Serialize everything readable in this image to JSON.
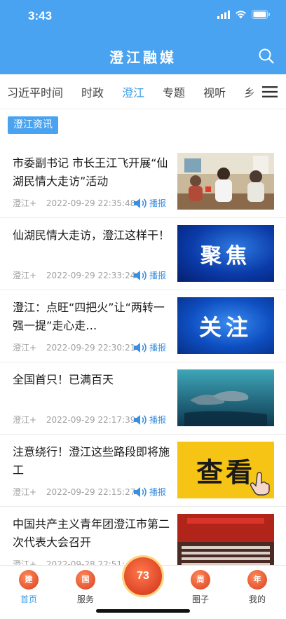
{
  "status_bar": {
    "time": "3:43"
  },
  "header": {
    "title": "澄江融媒"
  },
  "tabs": [
    {
      "label": "习近平时间"
    },
    {
      "label": "时政"
    },
    {
      "label": "澄江"
    },
    {
      "label": "专题"
    },
    {
      "label": "视听"
    },
    {
      "label": "乡"
    }
  ],
  "section_label": "澄江资讯",
  "news": [
    {
      "title": "市委副书记 市长王江飞开展“仙湖民情大走访”活动",
      "source": "澄江+",
      "time": "2022-09-29 22:35:48",
      "play": "播报",
      "thumb": "photo"
    },
    {
      "title": "仙湖民情大走访，澄江这样干！",
      "source": "澄江+",
      "time": "2022-09-29 22:33:24",
      "play": "播报",
      "thumb_text": "聚焦"
    },
    {
      "title": "澄江：点旺“四把火”让“两转一强一提”走心走…",
      "source": "澄江+",
      "time": "2022-09-29 22:30:21",
      "play": "播报",
      "thumb_text": "关注"
    },
    {
      "title": "全国首只！已满百天",
      "source": "澄江+",
      "time": "2022-09-29 22:17:39",
      "play": "播报",
      "thumb": "dolphin"
    },
    {
      "title": "注意绕行！澄江这些路段即将施工",
      "source": "澄江+",
      "time": "2022-09-29 22:15:27",
      "play": "播报",
      "thumb_text": "查看"
    },
    {
      "title": "中国共产主义青年团澄江市第二次代表大会召开",
      "source": "澄江+",
      "time": "2022-09-28 22:51:",
      "play": "",
      "thumb": "hall"
    }
  ],
  "tabbar": [
    {
      "label": "首页",
      "icon_char": "建"
    },
    {
      "label": "服务",
      "icon_char": "国"
    },
    {
      "label": "圈子",
      "icon_char": "周"
    },
    {
      "label": "我的",
      "icon_char": "年"
    }
  ],
  "center_badge": "73",
  "colors": {
    "brand": "#4aa3f0",
    "active_tab": "#3a9de8",
    "play": "#3a8fe0"
  }
}
